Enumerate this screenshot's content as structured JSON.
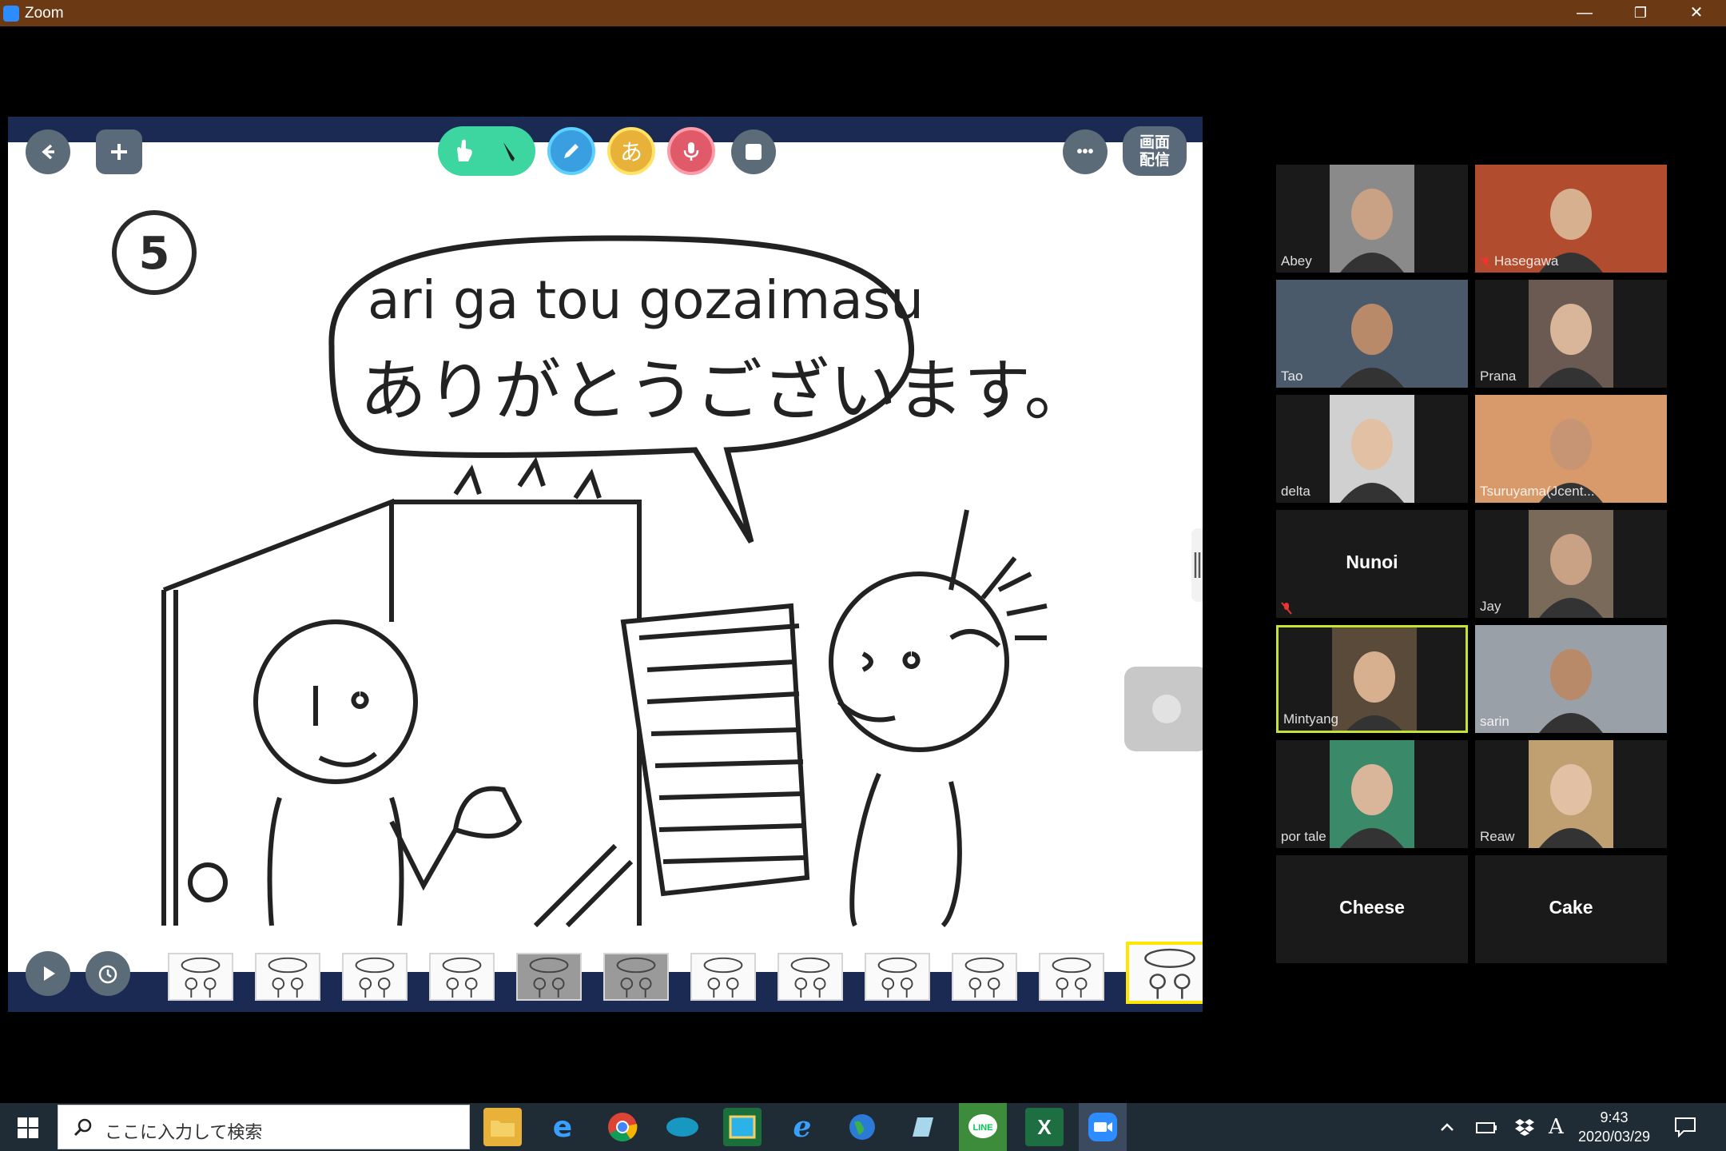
{
  "window": {
    "title": "Zoom",
    "minimize": "—",
    "restore": "❐",
    "close": "✕"
  },
  "whiteboard": {
    "top_toolbar": {
      "back_icon": "arrow-left-icon",
      "add_icon": "plus-icon",
      "hiragana_label": "あ",
      "more_label": "•••",
      "share_label": "画面\n配信"
    },
    "panel_number": "5",
    "speech_romaji": "ari ga tou gozaimasu",
    "speech_japanese": "ありがとうございます。",
    "thumbnail_count": 12,
    "active_thumbnail": 12
  },
  "participants": [
    {
      "name": "Abey",
      "muted": false
    },
    {
      "name": "Hasegawa",
      "muted": true
    },
    {
      "name": "Tao",
      "muted": false
    },
    {
      "name": "Prana",
      "muted": false
    },
    {
      "name": "delta",
      "muted": false
    },
    {
      "name": "Tsuruyama(Jcent...",
      "muted": false
    },
    {
      "name": "Nunoi",
      "muted": true
    },
    {
      "name": "Jay",
      "muted": false
    },
    {
      "name": "Mintyang",
      "muted": false,
      "speaking": true
    },
    {
      "name": "sarin",
      "muted": false
    },
    {
      "name": "por tale",
      "muted": false
    },
    {
      "name": "Reaw",
      "muted": false
    },
    {
      "name": "Cheese",
      "muted": false
    },
    {
      "name": "Cake",
      "muted": false
    }
  ],
  "taskbar": {
    "search_placeholder": "ここに入力して検索",
    "ime_label": "A",
    "time": "9:43",
    "date": "2020/03/29"
  }
}
